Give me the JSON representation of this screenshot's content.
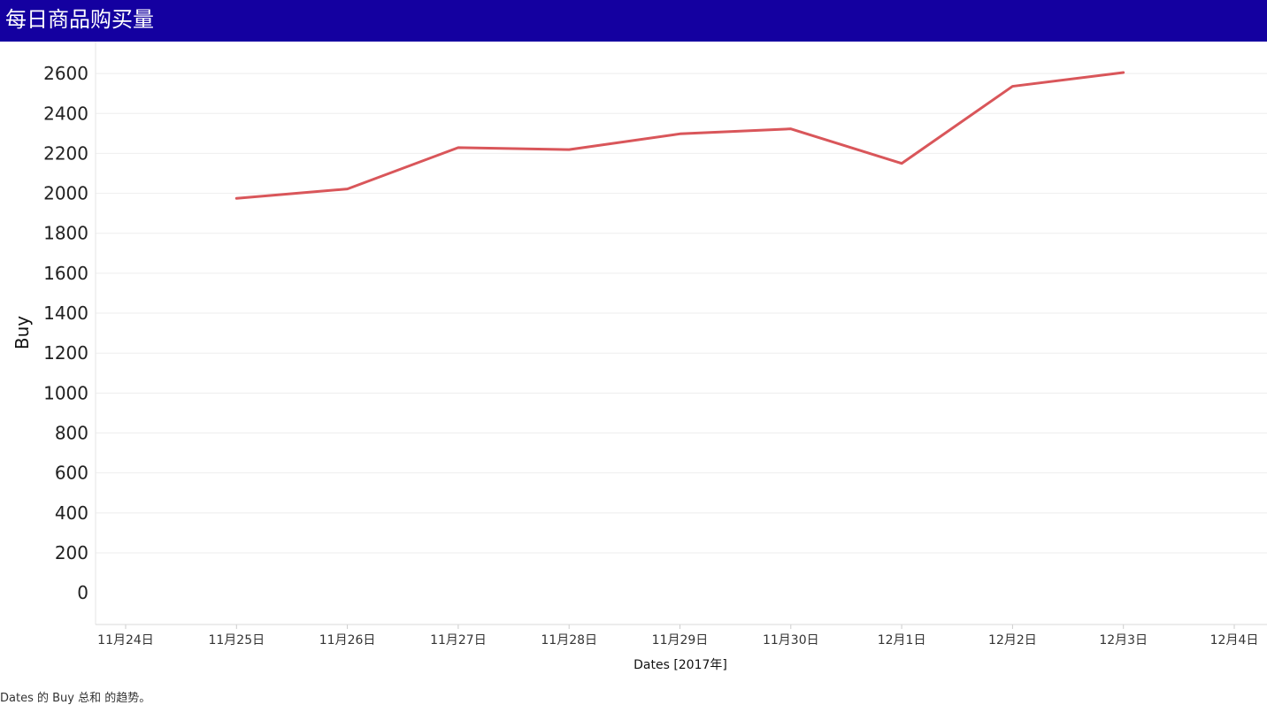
{
  "header": {
    "title": "每日商品购买量"
  },
  "caption": "Dates 的 Buy 总和 的趋势。",
  "colors": {
    "title_bar": "#1400a0",
    "line": "#d9565a",
    "grid": "#eeeeee"
  },
  "chart_data": {
    "type": "line",
    "title": "每日商品购买量",
    "xlabel": "Dates [2017年]",
    "ylabel": "Buy",
    "x_ticks": [
      "11月24日",
      "11月25日",
      "11月26日",
      "11月27日",
      "11月28日",
      "11月29日",
      "11月30日",
      "12月1日",
      "12月2日",
      "12月3日",
      "12月4日"
    ],
    "y_ticks": [
      0,
      200,
      400,
      600,
      800,
      1000,
      1200,
      1400,
      1600,
      1800,
      2000,
      2200,
      2400,
      2600
    ],
    "ylim": [
      -150,
      2760
    ],
    "grid": true,
    "series": [
      {
        "x": [
          "11月25日",
          "11月26日",
          "11月27日",
          "11月28日",
          "11月29日",
          "11月30日",
          "12月1日",
          "12月2日",
          "12月3日"
        ],
        "values": [
          1975,
          2022,
          2229,
          2219,
          2298,
          2323,
          2150,
          2536,
          2605
        ]
      }
    ]
  }
}
